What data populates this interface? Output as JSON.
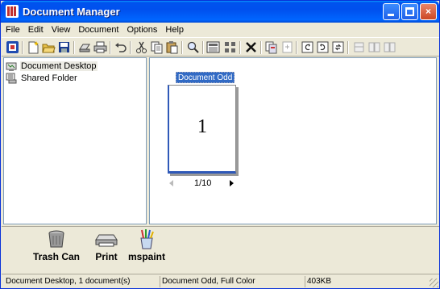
{
  "window": {
    "title": "Document Manager",
    "min_glyph": "",
    "max_glyph": "",
    "close_glyph": "×"
  },
  "menu": [
    "File",
    "Edit",
    "View",
    "Document",
    "Options",
    "Help"
  ],
  "toolbar": {
    "icons": [
      "app-icon",
      "new-icon",
      "open-icon",
      "save-icon",
      "scan-icon",
      "print-icon",
      "undo-icon",
      "cut-icon",
      "copy-icon",
      "paste-icon",
      "zoom-icon",
      "thumbnail-view-icon",
      "grid-view-icon",
      "delete-icon",
      "copy-page-icon",
      "insert-page-icon",
      "rotate-left-icon",
      "rotate-right-icon",
      "rotate-180-icon",
      "split-icon",
      "page-view-icon",
      "page-view-2-icon"
    ]
  },
  "tree": {
    "items": [
      {
        "label": "Document Desktop",
        "icon": "desktop-icon",
        "selected": true
      },
      {
        "label": "Shared Folder",
        "icon": "shared-folder-icon",
        "selected": false
      }
    ]
  },
  "document": {
    "title": "Document Odd",
    "page_number": "1",
    "pager_text": "1/10"
  },
  "dock": {
    "items": [
      {
        "label": "Trash Can",
        "icon": "trash-can-icon"
      },
      {
        "label": "Print",
        "icon": "printer-icon"
      },
      {
        "label": "mspaint",
        "icon": "paintbrush-icon"
      }
    ]
  },
  "status": {
    "left": "Document Desktop, 1 document(s)",
    "middle": "Document Odd, Full Color",
    "size": "403KB"
  }
}
